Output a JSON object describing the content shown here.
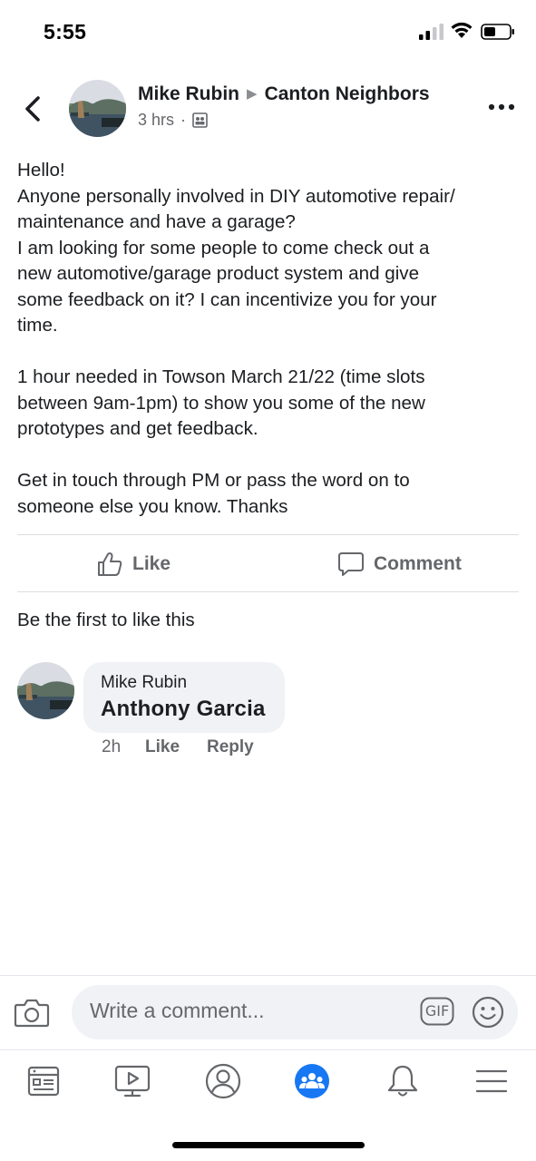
{
  "status_bar": {
    "time": "5:55"
  },
  "post": {
    "author": "Mike Rubin",
    "group": "Canton Neighbors",
    "timestamp": "3 hrs",
    "separator": "·",
    "paragraphs": [
      [
        "Hello!",
        "Anyone personally involved in DIY automotive repair/",
        "maintenance and have a garage?",
        "I am looking for some people to come check out a",
        "new automotive/garage product system and give",
        "some feedback on it? I can incentivize you for your",
        "time."
      ],
      [
        "1 hour needed in Towson March 21/22 (time slots",
        "between 9am-1pm) to show you some of the new",
        "prototypes and get feedback."
      ],
      [
        "Get in touch through PM or pass the word on to",
        "someone else you know. Thanks"
      ]
    ],
    "like_label": "Like",
    "comment_label": "Comment",
    "reactions_text": "Be the first to like this"
  },
  "comment": {
    "author": "Mike Rubin",
    "text": "Anthony Garcia",
    "time": "2h",
    "like_label": "Like",
    "reply_label": "Reply"
  },
  "composer": {
    "placeholder": "Write a comment...",
    "gif_label": "GIF"
  },
  "colors": {
    "text": "#1c1e21",
    "secondary": "#65676b",
    "accent": "#1877f2",
    "bubble": "#f0f2f5"
  },
  "nav": [
    "news-feed-icon",
    "watch-icon",
    "profile-icon",
    "groups-icon",
    "notifications-icon",
    "menu-icon"
  ]
}
